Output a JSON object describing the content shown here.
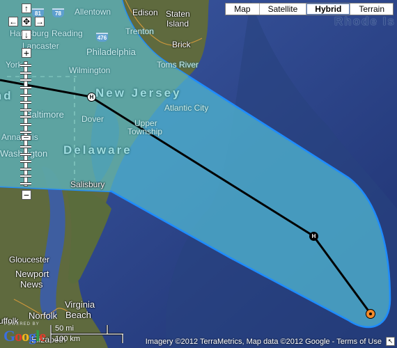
{
  "map": {
    "type": "hybrid",
    "colors": {
      "ocean": "#2a4080",
      "cone_fill": "#4fb3cf",
      "cone_border": "#1e8cff",
      "track": "#000000",
      "current_position": "#f08a2b"
    },
    "labels": {
      "cities": {
        "allentown": "Allentown",
        "edison": "Edison",
        "staten_island_1": "Staten",
        "staten_island_2": "Island",
        "rhode_island": "Rhode Is",
        "harrisburg": "Harrisburg",
        "reading": "Reading",
        "trenton": "Trenton",
        "lancaster": "Lancaster",
        "philadelphia": "Philadelphia",
        "brick": "Brick",
        "wilmington": "Wilmington",
        "toms_river": "Toms River",
        "york": "York",
        "baltimore": "Baltimore",
        "dover": "Dover",
        "atlantic_city": "Atlantic City",
        "annapolis": "Annapolis",
        "upper_township_1": "Upper",
        "upper_township_2": "Township",
        "washington": "Washington",
        "salisbury": "Salisbury",
        "gloucester": "Gloucester",
        "newport_news_1": "Newport",
        "newport_news_2": "News",
        "norfolk": "Norfolk",
        "virginia_beach_1": "Virginia",
        "virginia_beach_2": "Beach",
        "suffolk": "Suffolk",
        "elizabeth_city": "Elizabeth"
      },
      "states": {
        "new_jersey": "New Jersey",
        "delaware": "Delaware",
        "maryland": "Maryland"
      },
      "highways": {
        "i78": "78",
        "i476": "476",
        "i81": "81"
      }
    },
    "track_markers": [
      {
        "label": "H",
        "kind": "hurricane-forecast"
      },
      {
        "label": "H",
        "kind": "hurricane-forecast"
      },
      {
        "label": "",
        "kind": "current-position"
      }
    ]
  },
  "controls": {
    "pan": {
      "up": "↑",
      "down": "↓",
      "left": "←",
      "right": "→",
      "center": "✥"
    },
    "zoom_in": "+",
    "zoom_out": "−",
    "zoom_level_fraction": 0.62,
    "zoom_ticks": 17
  },
  "map_types": {
    "options": [
      "Map",
      "Satellite",
      "Hybrid",
      "Terrain"
    ],
    "selected": "Hybrid"
  },
  "scale": {
    "miles": "50 mi",
    "km": "100 km"
  },
  "branding": {
    "powered_by": "POWERED BY",
    "google": "Google"
  },
  "attribution": "Imagery ©2012 TerraMetrics, Map data ©2012 Google - Terms of Use",
  "expand_icon": "↖"
}
